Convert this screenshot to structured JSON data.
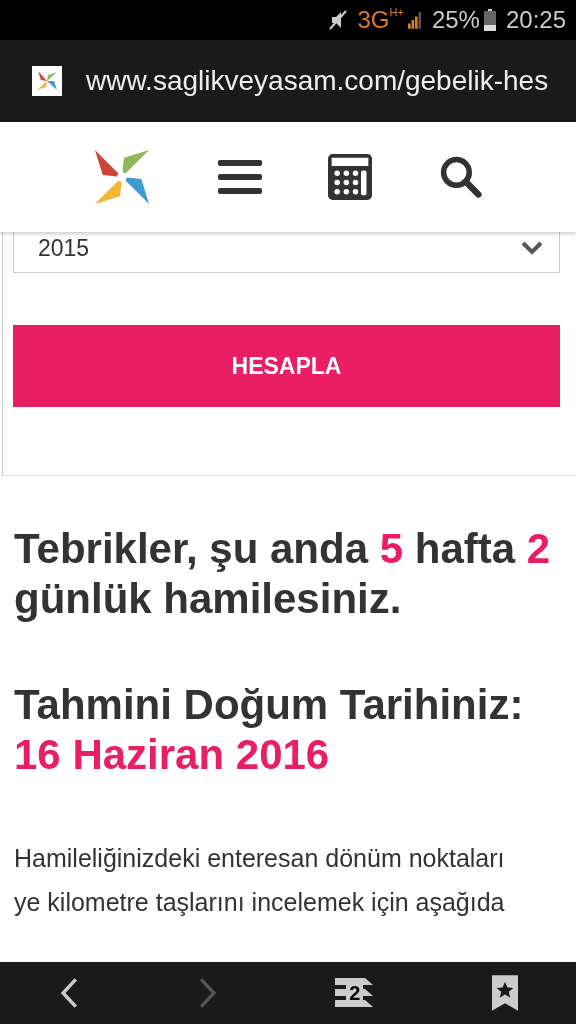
{
  "status_bar": {
    "network": "3G",
    "network_badge": "H+",
    "battery": "25%",
    "time": "20:25"
  },
  "address_bar": {
    "url": "www.saglikveyasam.com/gebelik-hes"
  },
  "form": {
    "year_select": {
      "value": "2015"
    },
    "submit_label": "HESAPLA"
  },
  "result": {
    "headings": [
      {
        "parts": [
          {
            "text": "Tebrikler, şu anda ",
            "accent": false
          },
          {
            "text": "5",
            "accent": true
          },
          {
            "text": " hafta ",
            "accent": false
          },
          {
            "text": "2",
            "accent": true
          },
          {
            "text": " günlük hamilesiniz.",
            "accent": false
          }
        ]
      },
      {
        "parts": [
          {
            "text": "Tahmini Doğum Tarihiniz: ",
            "accent": false
          },
          {
            "text": "16 Haziran 2016",
            "accent": true
          }
        ]
      }
    ],
    "paragraph": "Hamileliğinizdeki enteresan dönüm noktaları ye kilometre taşlarını incelemek için aşağıda"
  },
  "bottom_bar": {
    "back_disabled": false,
    "forward_disabled": true,
    "tab_count": "2"
  }
}
